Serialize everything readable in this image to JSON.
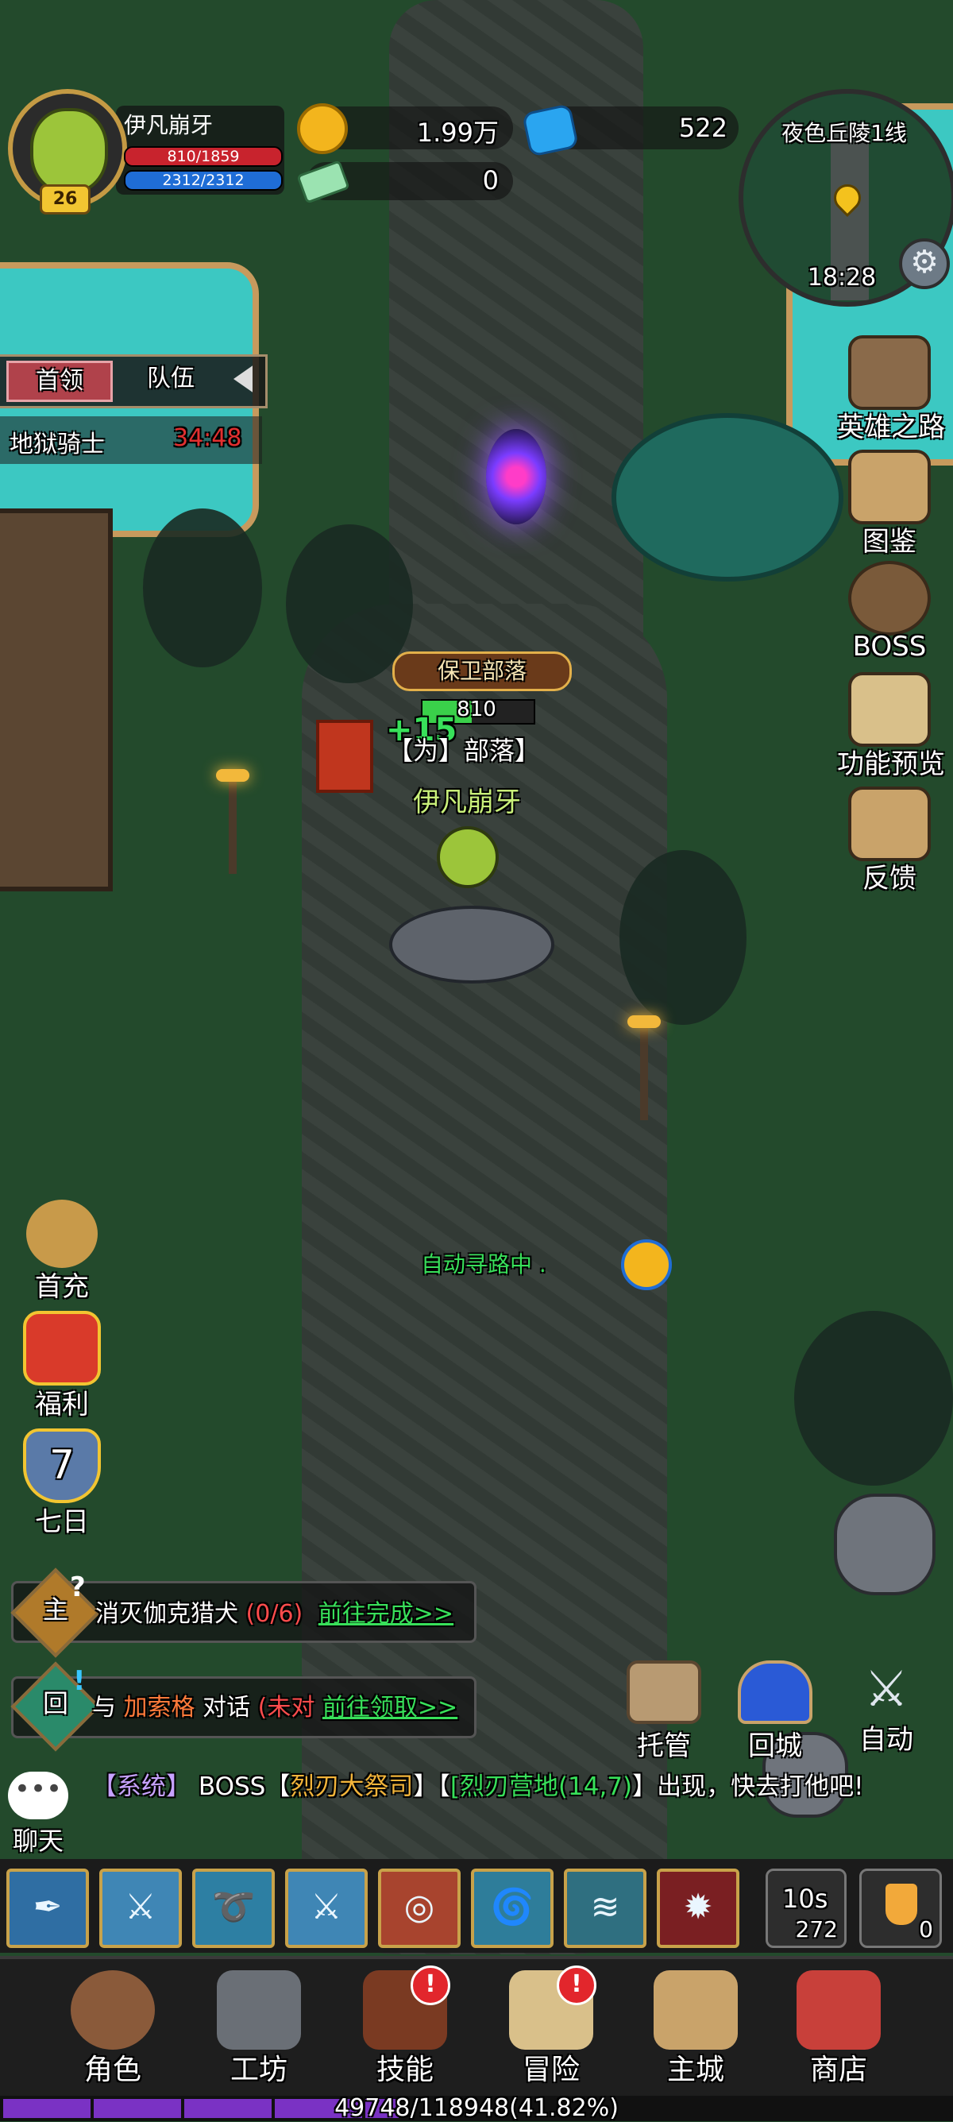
{
  "player": {
    "name": "伊凡崩牙",
    "level": "26",
    "hp": "810/1859",
    "hp_fraction": 0.436,
    "mp": "2312/2312",
    "mp_fraction": 1.0
  },
  "currency": {
    "gold": "1.99万",
    "gems": "522",
    "tickets": "0"
  },
  "minimap": {
    "location": "夜色丘陵1线",
    "time": "18:28"
  },
  "left_panel": {
    "tab_boss": "首领",
    "tab_team": "队伍",
    "boss_name": "地狱骑士",
    "boss_timer": "34:48"
  },
  "right_menu": [
    {
      "label": "英雄之路",
      "icon": "sword-banner-icon"
    },
    {
      "label": "图鉴",
      "icon": "book-icon"
    },
    {
      "label": "BOSS",
      "icon": "boss-skull-icon"
    },
    {
      "label": "功能预览",
      "icon": "scroll-preview-icon"
    },
    {
      "label": "反馈",
      "icon": "envelope-icon"
    }
  ],
  "left_menu": [
    {
      "label": "首充",
      "icon": "money-bag-icon"
    },
    {
      "label": "福利",
      "icon": "gift-box-icon"
    },
    {
      "label": "七日",
      "icon": "seven-day-shield-icon",
      "number": "7"
    }
  ],
  "world": {
    "event_banner": "保卫部落",
    "floating_number": "+15",
    "unit_number": "810",
    "guild_tag": "【为】部落】",
    "character_name": "伊凡崩牙",
    "auto_path_text": "自动寻路中 ."
  },
  "quests": [
    {
      "type": "主",
      "text_white": "消灭伽克猎犬",
      "progress": "(0/6)",
      "action": "前往完成>>"
    },
    {
      "type": "回",
      "text_white": "与",
      "npc": "加索格",
      "text_white2": "对话",
      "progress": "(未对",
      "action": "前往领取>>"
    }
  ],
  "chat": {
    "label": "聊天",
    "message": {
      "tag": "【系统】",
      "p1": " BOSS【",
      "boss": "烈刃大祭司",
      "p2": "】【",
      "place": "[烈刃营地(14,7)",
      "p3": "】出现，快去打他吧!"
    }
  },
  "action_buttons": [
    {
      "label": "托管",
      "icon": "chat-dots-icon"
    },
    {
      "label": "回城",
      "icon": "portal-icon"
    },
    {
      "label": "自动",
      "icon": "crossed-swords-icon"
    }
  ],
  "skills": [
    "quill-skill-icon",
    "blade-skill-icon",
    "whistle-skill-icon",
    "slash-skill-icon",
    "target-skill-icon",
    "whirlwind-skill-icon",
    "wind-skill-icon",
    "fang-skill-icon"
  ],
  "skill_glyphs": [
    "✒",
    "⚔",
    "➰",
    "⚔",
    "◎",
    "🌀",
    "≋",
    "✹"
  ],
  "skill_colors": [
    "#2f6ea3",
    "#3f86b5",
    "#2d7fa3",
    "#3f86b5",
    "#a8442e",
    "#2e7d9a",
    "#2f6f80",
    "#7a1f22"
  ],
  "timer_slot": {
    "seconds": "10s",
    "count": "272"
  },
  "potion_slot": {
    "count": "0"
  },
  "bottom_nav": [
    {
      "label": "角色",
      "icon": "hero-portrait-icon",
      "badge": ""
    },
    {
      "label": "工坊",
      "icon": "anvil-hammer-icon",
      "badge": ""
    },
    {
      "label": "技能",
      "icon": "skill-book-icon",
      "badge": "!"
    },
    {
      "label": "冒险",
      "icon": "map-scroll-icon",
      "badge": "!"
    },
    {
      "label": "主城",
      "icon": "castle-icon",
      "badge": ""
    },
    {
      "label": "商店",
      "icon": "shop-stall-icon",
      "badge": ""
    }
  ],
  "exp": {
    "text": "49748/118948(41.82%)",
    "fraction": 0.4182
  },
  "colors": {
    "accent_green": "#38e05a",
    "quest_red": "#ff4c4c",
    "gold": "#f3b51d"
  }
}
